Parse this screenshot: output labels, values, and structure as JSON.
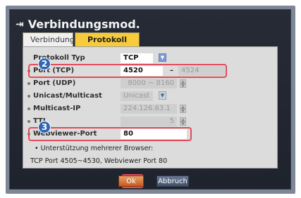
{
  "dialog": {
    "title": "Verbindungsmod.",
    "title_icon": "login-icon",
    "tabs": [
      {
        "label": "Verbindung",
        "active": false
      },
      {
        "label": "Protokoll",
        "active": true
      }
    ]
  },
  "settings": {
    "protocol_type": {
      "label": "Protokoll Typ",
      "value": "TCP"
    },
    "port_tcp": {
      "label": "Port (TCP)",
      "value": "4520",
      "separator": "–",
      "range_end": "4524"
    },
    "port_udp": {
      "label": "Port (UDP)",
      "value": "8000 ~ 8160"
    },
    "unicast_multicast": {
      "label": "Unicast/Multicast",
      "value": "Unicast"
    },
    "multicast_ip": {
      "label": "Multicast-IP",
      "value": "224.126.63.1"
    },
    "ttl": {
      "label": "TTL",
      "value": "5"
    },
    "webviewer_port": {
      "label": "Webviewer-Port",
      "value": "80"
    }
  },
  "notes": {
    "line1": "• Unterstützung mehrerer Browser:",
    "line2": "TCP Port 4505~4530, Webviewer Port 80"
  },
  "buttons": {
    "ok": "Ok",
    "cancel": "Abbruch"
  },
  "callouts": {
    "port": "2",
    "webviewer": "3"
  },
  "colors": {
    "active_tab": "#f7cb3a",
    "highlight": "#e34a5a",
    "badge": "#2f66b4",
    "ok_button": "#d4773b"
  }
}
